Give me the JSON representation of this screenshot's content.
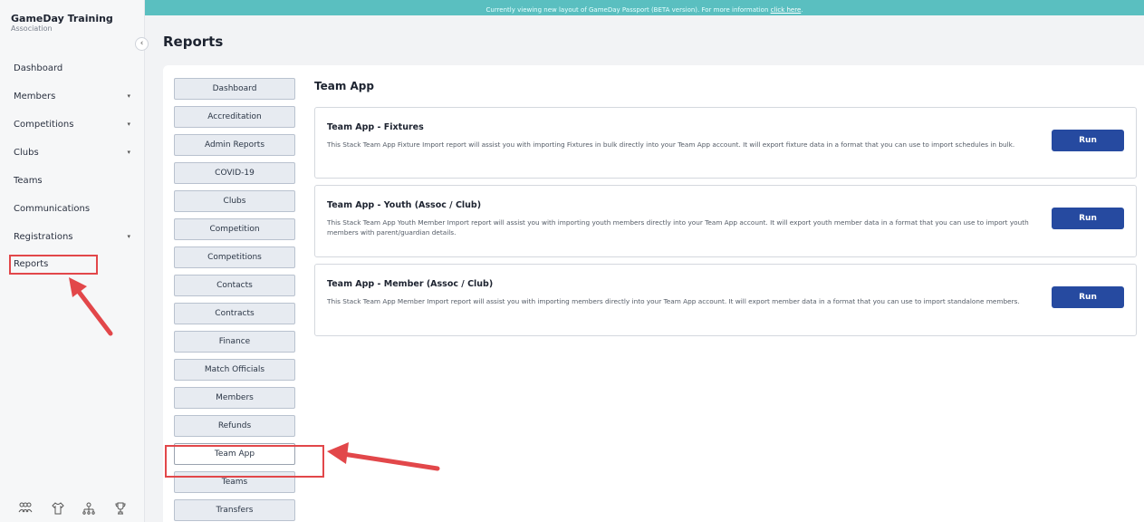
{
  "org": {
    "name": "GameDay Training",
    "subtitle": "Association"
  },
  "sidebar": {
    "collapse_glyph": "‹",
    "items": [
      {
        "label": "Dashboard",
        "has_caret": false
      },
      {
        "label": "Members",
        "has_caret": true
      },
      {
        "label": "Competitions",
        "has_caret": true
      },
      {
        "label": "Clubs",
        "has_caret": true
      },
      {
        "label": "Teams",
        "has_caret": false
      },
      {
        "label": "Communications",
        "has_caret": false
      },
      {
        "label": "Registrations",
        "has_caret": true
      },
      {
        "label": "Reports",
        "has_caret": false
      }
    ],
    "caret_glyph": "▾",
    "bottom_icons": [
      "people-icon",
      "shirt-icon",
      "hierarchy-icon",
      "trophy-icon"
    ]
  },
  "banner": {
    "text": "Currently viewing new layout of GameDay Passport (BETA version). For more information ",
    "link_text": "click here",
    "suffix": "."
  },
  "page_title": "Reports",
  "report_nav": {
    "items": [
      "Dashboard",
      "Accreditation",
      "Admin Reports",
      "COVID-19",
      "Clubs",
      "Competition",
      "Competitions",
      "Contacts",
      "Contracts",
      "Finance",
      "Match Officials",
      "Members",
      "Refunds",
      "Team App",
      "Teams",
      "Transfers"
    ],
    "active": "Team App"
  },
  "section_title": "Team App",
  "cards": [
    {
      "title": "Team App - Fixtures",
      "description": "This Stack Team App Fixture Import report will assist you with importing Fixtures in bulk directly into your Team App account. It will export fixture data in a format that you can use to import schedules in bulk.",
      "button": "Run"
    },
    {
      "title": "Team App - Youth (Assoc / Club)",
      "description": "This Stack Team App Youth Member Import report will assist you with importing youth members directly into your Team App account. It will export youth member data in a format that you can use to import youth members with parent/guardian details.",
      "button": "Run"
    },
    {
      "title": "Team App - Member (Assoc / Club)",
      "description": "This Stack Team App Member Import report will assist you with importing members directly into your Team App account. It will export member data in a format that you can use to import standalone members.",
      "button": "Run"
    }
  ],
  "colors": {
    "banner": "#5abfc0",
    "run_button": "#264aa0",
    "highlight": "#e2474a"
  }
}
